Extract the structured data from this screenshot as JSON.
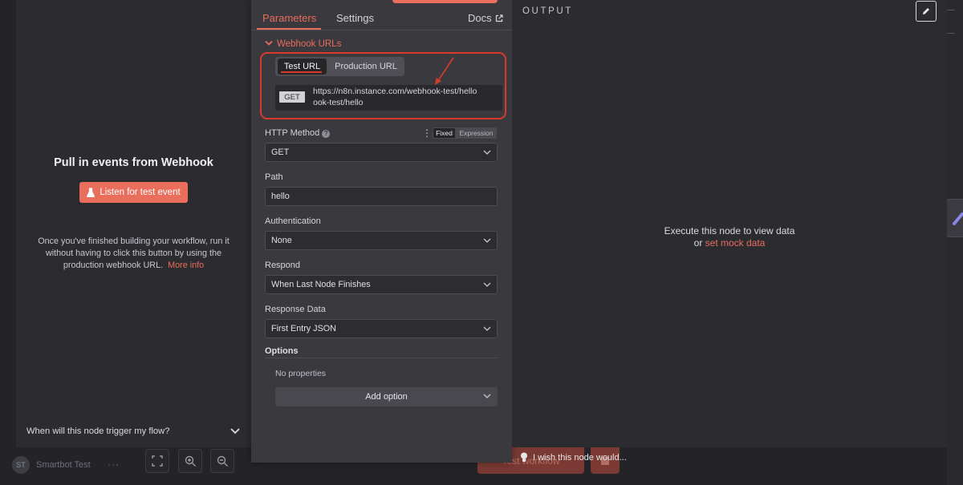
{
  "input_panel": {
    "title": "Pull in events from Webhook",
    "listen_button": "Listen for test event",
    "help_text": "Once you've finished building your workflow, run it without having to click this button by using the production webhook URL.",
    "more_info": "More info",
    "trigger_question": "When will this node trigger my flow?"
  },
  "canvas": {
    "avatar_initials": "ST",
    "username": "Smartbot Test",
    "user_menu": "···",
    "test_workflow_label": "Test workflow",
    "wish_text": "I wish this node would..."
  },
  "settings": {
    "tabs": {
      "parameters": "Parameters",
      "settings": "Settings",
      "docs": "Docs"
    },
    "webhook_section": "Webhook URLs",
    "url_tabs": {
      "test": "Test URL",
      "production": "Production URL"
    },
    "url": {
      "method": "GET",
      "line1": "https://n8n.instance.com/webhook-test/hello",
      "line2": "ook-test/hello"
    },
    "http_method": {
      "label": "HTTP Method",
      "value": "GET",
      "fixed": "Fixed",
      "expression": "Expression"
    },
    "path": {
      "label": "Path",
      "value": "hello"
    },
    "authentication": {
      "label": "Authentication",
      "value": "None"
    },
    "respond": {
      "label": "Respond",
      "value": "When Last Node Finishes"
    },
    "response_data": {
      "label": "Response Data",
      "value": "First Entry JSON"
    },
    "options": {
      "label": "Options",
      "empty": "No properties",
      "add_button": "Add option"
    }
  },
  "output": {
    "label": "OUTPUT",
    "message": "Execute this node to view data",
    "or": "or",
    "mock_link": "set mock data"
  },
  "colors": {
    "accent": "#ea6e5c",
    "annotation": "#d93a2b"
  }
}
